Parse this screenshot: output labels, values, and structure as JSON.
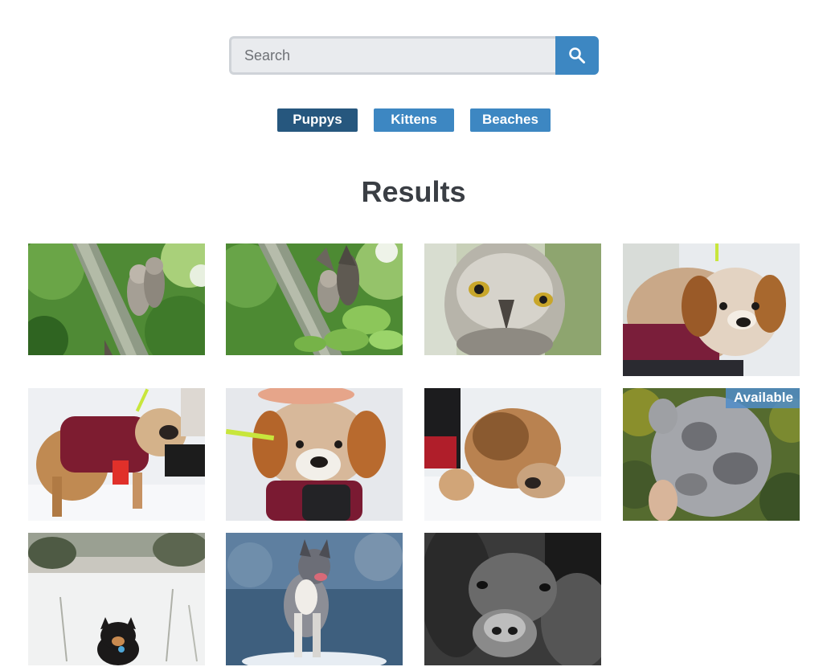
{
  "search": {
    "placeholder": "Search",
    "value": "",
    "button_icon": "search-icon"
  },
  "categories": [
    {
      "label": "Puppys",
      "active": true
    },
    {
      "label": "Kittens",
      "active": false
    },
    {
      "label": "Beaches",
      "active": false
    }
  ],
  "results_title": "Results",
  "images": [
    {
      "subject": "owl chicks on lichen branch",
      "badge": ""
    },
    {
      "subject": "owl chicks in leaves",
      "badge": ""
    },
    {
      "subject": "owl face close-up",
      "badge": ""
    },
    {
      "subject": "fluffy puppy in red coat",
      "badge": ""
    },
    {
      "subject": "puppy in red coat on snow",
      "badge": ""
    },
    {
      "subject": "puppy with snowy face",
      "badge": ""
    },
    {
      "subject": "puppy sniffing snow",
      "badge": ""
    },
    {
      "subject": "merle puppy held in hand",
      "badge": "Available"
    },
    {
      "subject": "black puppy sitting in snow",
      "badge": ""
    },
    {
      "subject": "australian shepherd on rock",
      "badge": ""
    },
    {
      "subject": "black and white spaniel close-up",
      "badge": ""
    }
  ],
  "colors": {
    "accent": "#3d87c2",
    "accent_active": "#26577e",
    "heading": "#3a3e44"
  }
}
